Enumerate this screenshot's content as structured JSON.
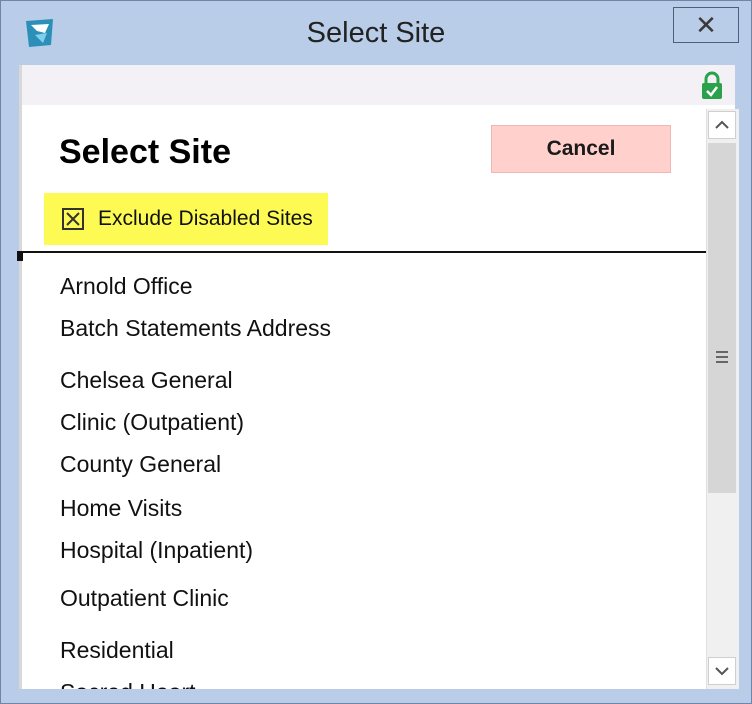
{
  "window": {
    "title": "Select Site",
    "close_label": "✕"
  },
  "dialog": {
    "heading": "Select Site",
    "cancel_label": "Cancel",
    "exclude_label": "Exclude Disabled Sites",
    "exclude_checked": true
  },
  "sites": [
    "Arnold Office",
    "Batch Statements Address",
    "Chelsea General",
    "Clinic (Outpatient)",
    "County General",
    "Home Visits",
    "Hospital (Inpatient)",
    "Outpatient Clinic",
    "Residential",
    "Sacred Heart"
  ],
  "icons": {
    "app": "app-logo-icon",
    "lock": "lock-icon",
    "scroll_up": "chevron-up-icon",
    "scroll_down": "chevron-down-icon"
  },
  "colors": {
    "titlebar": "#b9cde8",
    "cancel_bg": "#ffd0cc",
    "highlight": "#fdfb53",
    "lock": "#2aa14a"
  }
}
